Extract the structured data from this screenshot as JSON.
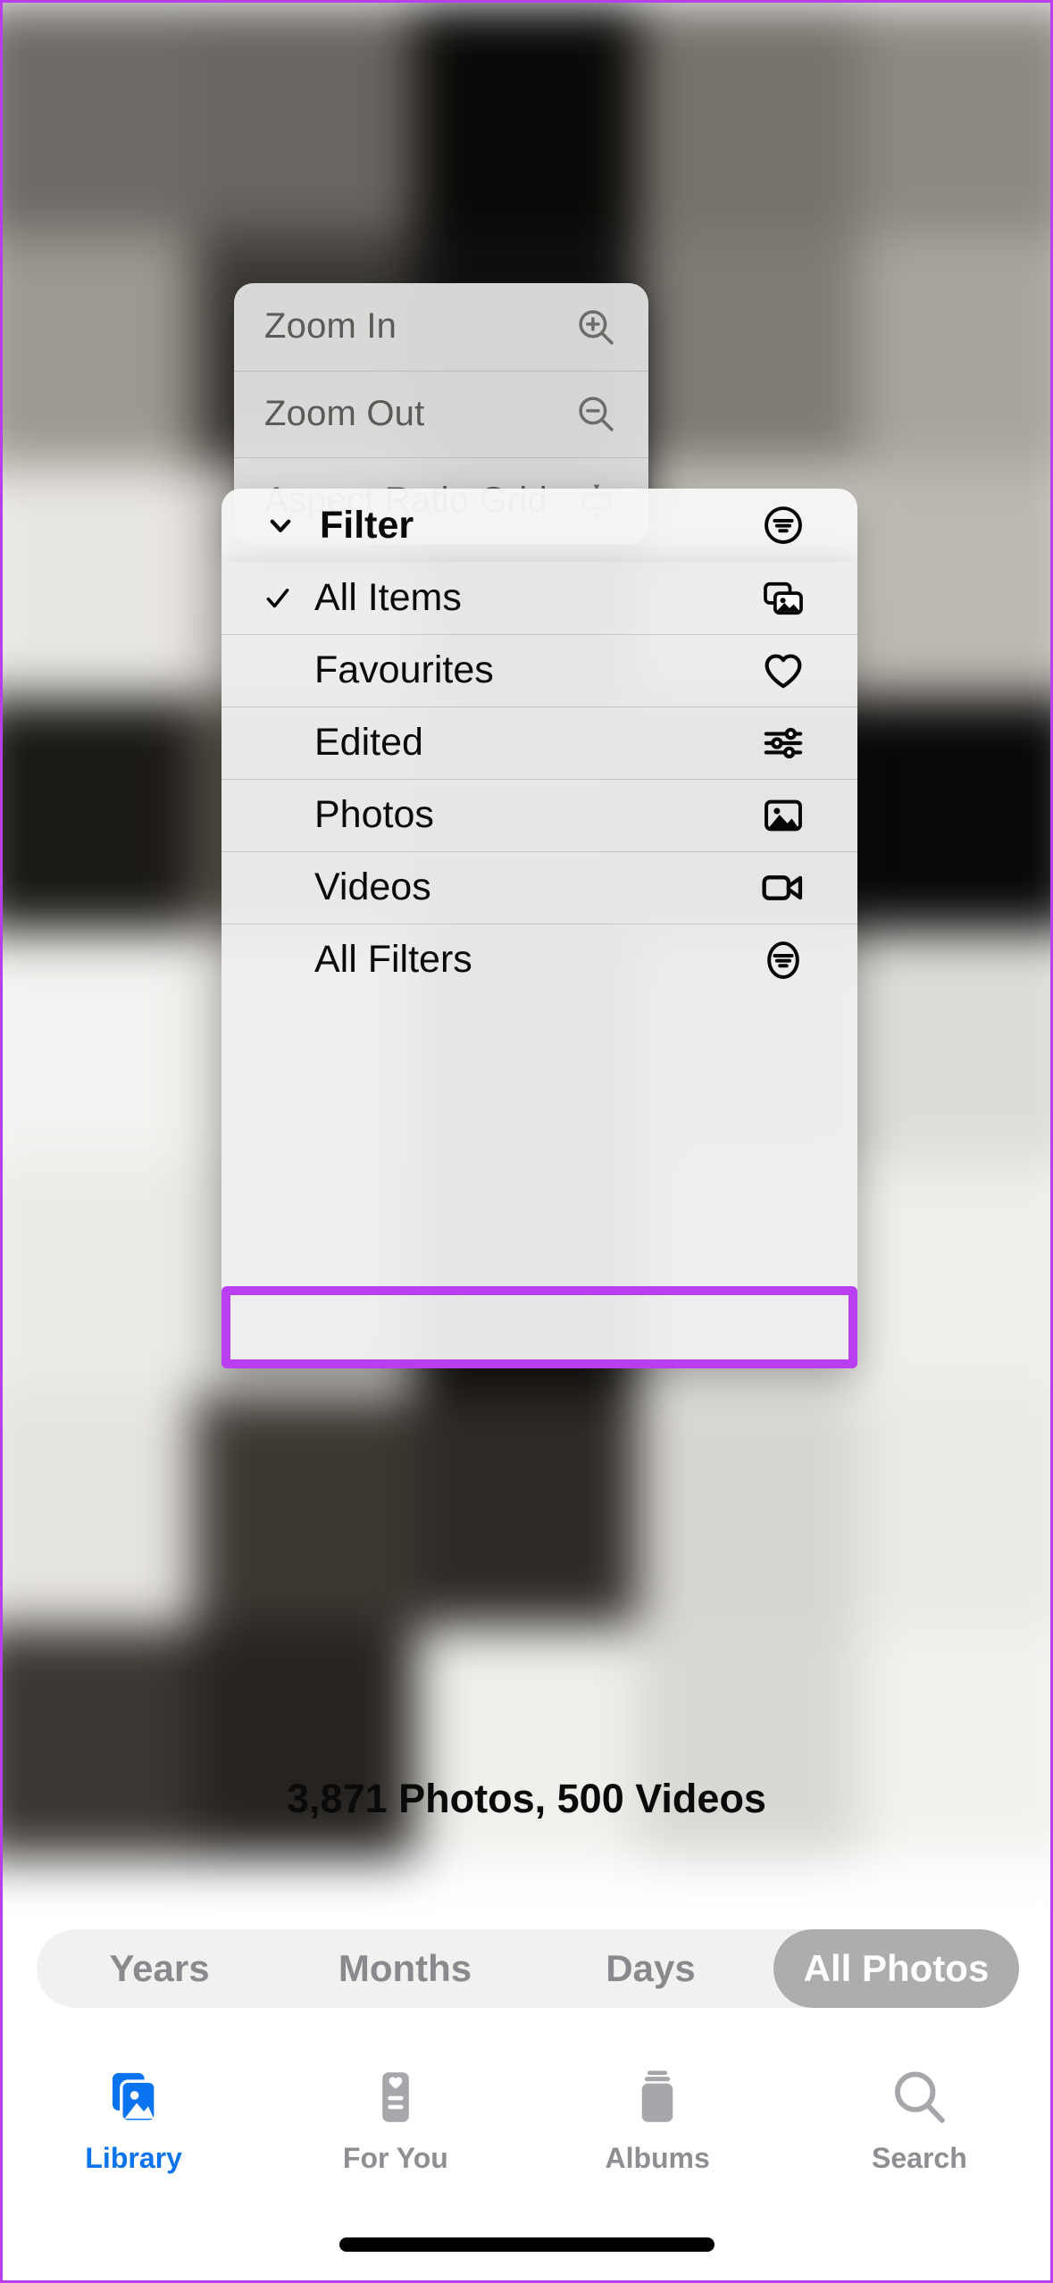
{
  "app": {
    "name": "Photos",
    "highlight_color": "#b93ef0",
    "accent_color": "#0a74f0"
  },
  "zoom_menu": {
    "items": [
      {
        "label": "Zoom In",
        "icon": "magnifier-plus-icon"
      },
      {
        "label": "Zoom Out",
        "icon": "magnifier-minus-icon"
      },
      {
        "label": "Aspect Ratio Grid",
        "icon": "aspect-ratio-grid-icon"
      }
    ]
  },
  "filter_menu": {
    "header": {
      "label": "Filter",
      "chevron": "chevron-down-icon",
      "icon": "filter-circle-icon"
    },
    "items": [
      {
        "label": "All Items",
        "icon": "photo-stack-icon",
        "checked": true,
        "check": "checkmark-icon"
      },
      {
        "label": "Favourites",
        "icon": "heart-icon",
        "checked": false,
        "check": ""
      },
      {
        "label": "Edited",
        "icon": "sliders-icon",
        "checked": false,
        "check": ""
      },
      {
        "label": "Photos",
        "icon": "photo-icon",
        "checked": false,
        "check": ""
      },
      {
        "label": "Videos",
        "icon": "video-camera-icon",
        "checked": false,
        "check": ""
      },
      {
        "label": "All Filters",
        "icon": "filter-circle-icon",
        "checked": false,
        "check": "",
        "highlighted": true
      }
    ]
  },
  "library": {
    "count_text": "3,871 Photos, 500 Videos",
    "segments": [
      {
        "label": "Years",
        "active": false
      },
      {
        "label": "Months",
        "active": false
      },
      {
        "label": "Days",
        "active": false
      },
      {
        "label": "All Photos",
        "active": true
      }
    ]
  },
  "tabbar": {
    "tabs": [
      {
        "label": "Library",
        "icon": "photo-stack-icon",
        "active": true
      },
      {
        "label": "For You",
        "icon": "for-you-icon",
        "active": false
      },
      {
        "label": "Albums",
        "icon": "albums-icon",
        "active": false
      },
      {
        "label": "Search",
        "icon": "search-icon",
        "active": false
      }
    ]
  }
}
